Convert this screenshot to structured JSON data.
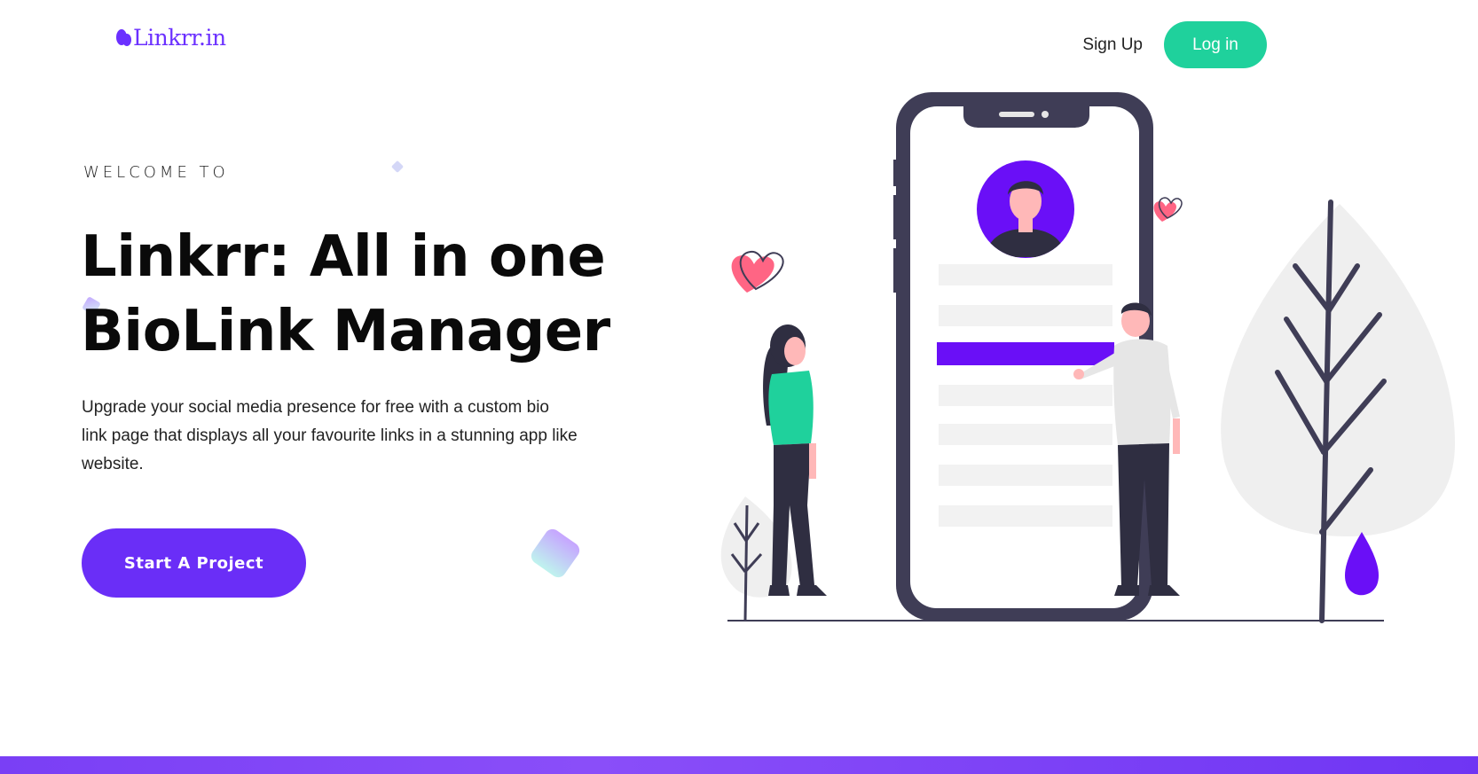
{
  "header": {
    "logo_text": "Linkrr.in",
    "signup_label": "Sign Up",
    "login_label": "Log in"
  },
  "hero": {
    "eyebrow": "WELCOME TO",
    "headline_line1": "Linkrr: All in one",
    "headline_line2": "BioLink Manager",
    "description": "Upgrade your social media presence for free with a custom bio link page that displays all your favourite links in a stunning app like website.",
    "cta_label": "Start A Project"
  },
  "colors": {
    "brand_purple": "#6a2ef7",
    "login_green": "#1fd19c",
    "phone_frame": "#3f3d56",
    "accent_pink": "#ff6584"
  },
  "icons": [
    "logo-mark-icon",
    "heart-icon"
  ]
}
